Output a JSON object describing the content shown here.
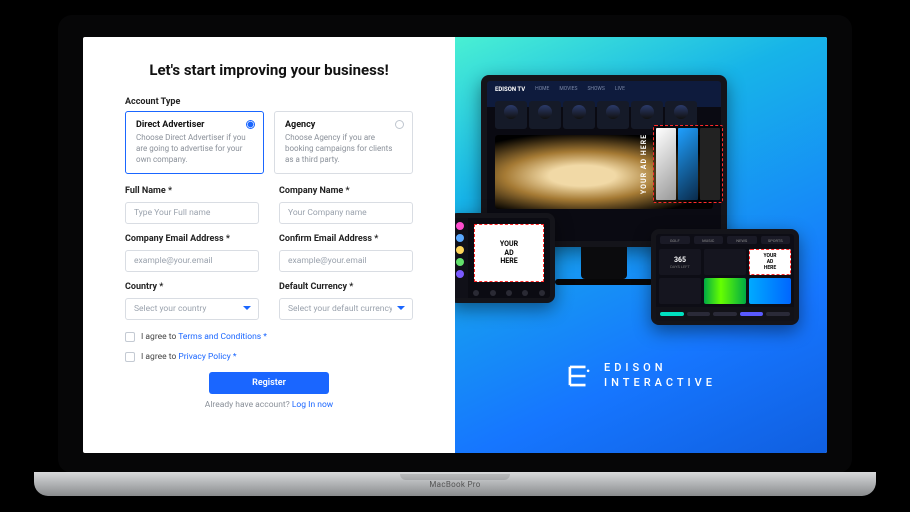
{
  "headline": "Let's start improving your business!",
  "accountType": {
    "label": "Account Type",
    "options": [
      {
        "title": "Direct Advertiser",
        "desc": "Choose Direct Advertiser if you are going to advertise for your own company.",
        "selected": true
      },
      {
        "title": "Agency",
        "desc": "Choose Agency if you are booking campaigns for clients as a third party.",
        "selected": false
      }
    ]
  },
  "fields": {
    "fullName": {
      "label": "Full Name *",
      "placeholder": "Type Your Full name"
    },
    "companyName": {
      "label": "Company Name *",
      "placeholder": "Your Company name"
    },
    "email": {
      "label": "Company Email Address *",
      "placeholder": "example@your.email"
    },
    "confirmEmail": {
      "label": "Confirm Email Address *",
      "placeholder": "example@your.email"
    },
    "country": {
      "label": "Country *",
      "placeholder": "Select your country"
    },
    "currency": {
      "label": "Default Currency *",
      "placeholder": "Select your default currency"
    }
  },
  "checks": {
    "termsPrefix": "I agree to ",
    "termsLink": "Terms and Conditions *",
    "privacyPrefix": "I agree to ",
    "privacyLink": "Privacy Policy *"
  },
  "actions": {
    "register": "Register",
    "loginPrefix": "Already have account? ",
    "loginLink": "Log In now"
  },
  "promo": {
    "brand1": "EDISON",
    "brand2": "INTERACTIVE",
    "tvBrand": "EDISON TV",
    "adLabelVertical": "YOUR AD HERE",
    "adLabelBlock": "YOUR\nAD\nHERE",
    "dashStat": "365",
    "dashAd": "YOUR\nAD\nHERE"
  },
  "hardware": {
    "baseLabel": "MacBook Pro"
  }
}
